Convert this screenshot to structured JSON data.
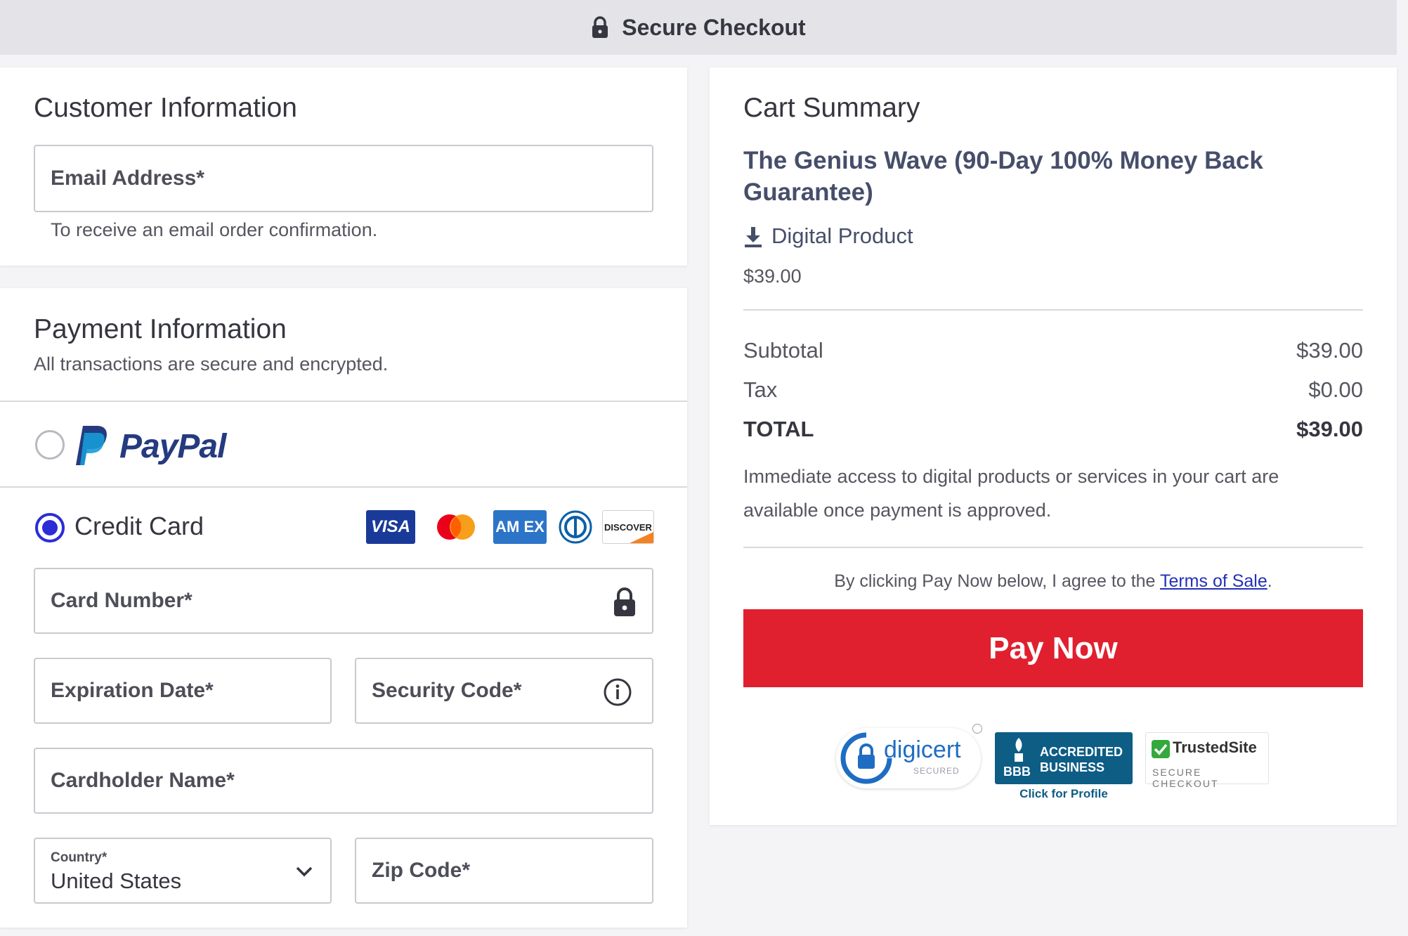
{
  "header": {
    "title": "Secure Checkout",
    "icon": "lock-icon"
  },
  "customer": {
    "title": "Customer Information",
    "email_placeholder": "Email Address*",
    "email_helper": "To receive an email order confirmation."
  },
  "payment": {
    "title": "Payment Information",
    "subtitle": "All transactions are secure and encrypted.",
    "options": {
      "paypal_label": "PayPal",
      "credit_card_label": "Credit Card"
    },
    "selected_option": "Credit Card",
    "card_brands": [
      "VISA",
      "Mastercard",
      "AMEX",
      "Diners Club",
      "DISCOVER"
    ],
    "brand_text": {
      "visa": "VISA",
      "amex": "AM EX",
      "discover": "DISCOVER"
    },
    "fields": {
      "card_number": "Card Number*",
      "expiration": "Expiration Date*",
      "security_code": "Security Code*",
      "cardholder": "Cardholder Name*",
      "country_label": "Country*",
      "country_value": "United States",
      "zip": "Zip Code*"
    }
  },
  "cart": {
    "title": "Cart Summary",
    "product_name": "The Genius Wave (90-Day 100% Money Back Guarantee)",
    "product_type": "Digital Product",
    "product_price": "$39.00",
    "subtotal_label": "Subtotal",
    "subtotal_value": "$39.00",
    "tax_label": "Tax",
    "tax_value": "$0.00",
    "total_label": "TOTAL",
    "total_value": "$39.00",
    "access_note": "Immediate access to digital products or services in your cart are available once payment is approved.",
    "terms_prefix": "By clicking Pay Now below, I agree to the ",
    "terms_link": "Terms of Sale",
    "terms_suffix": ".",
    "pay_button": "Pay Now",
    "badges": {
      "digicert": "digicert",
      "digicert_sub": "SECURED",
      "bbb_line1": "ACCREDITED",
      "bbb_line2": "BUSINESS",
      "bbb_abbr": "BBB",
      "bbb_caption": "Click for Profile",
      "trusted_name": "TrustedSite",
      "trusted_sub": "SECURE CHECKOUT"
    }
  },
  "colors": {
    "accent": "#2b2dd6",
    "pay_button": "#e0202f",
    "link": "#2331b8",
    "paypal_dark": "#253b80",
    "paypal_light": "#179bd7"
  }
}
